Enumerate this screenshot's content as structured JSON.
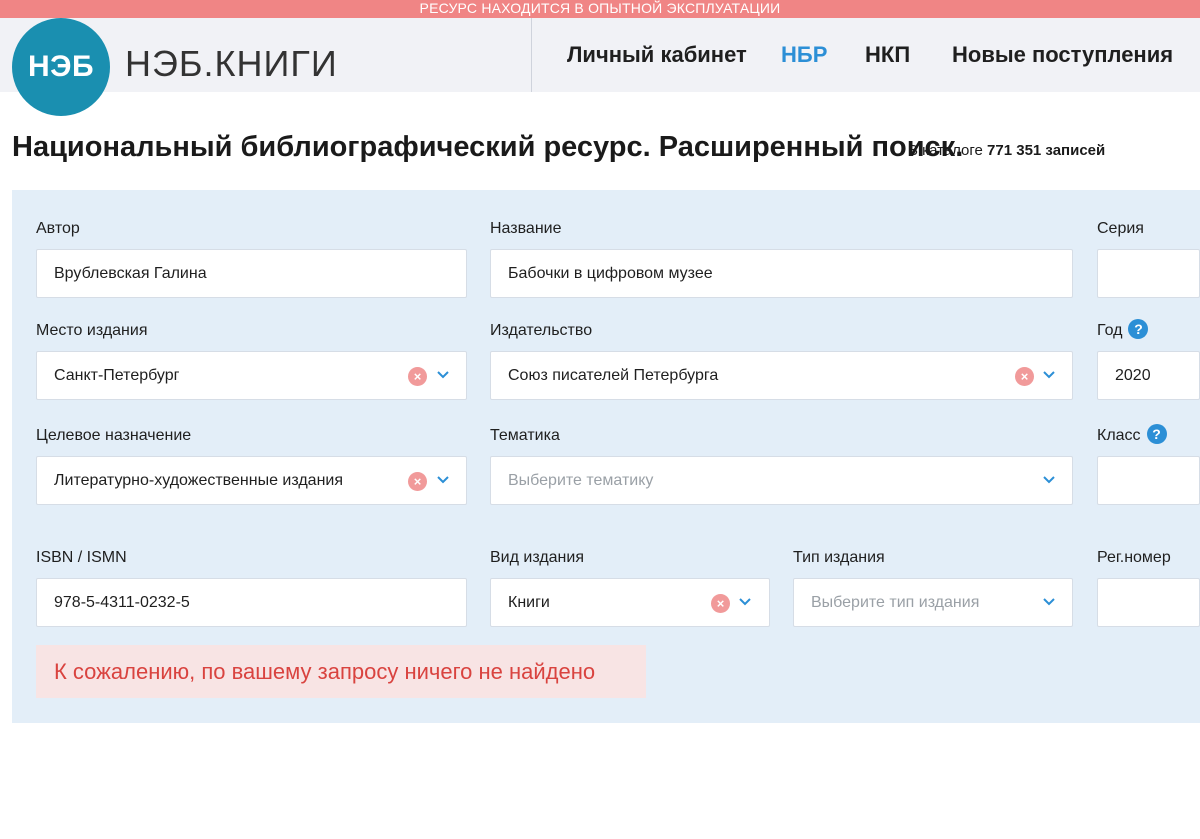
{
  "banner": "РЕСУРС НАХОДИТСЯ В ОПЫТНОЙ ЭКСПЛУАТАЦИИ",
  "logo": {
    "mark": "НЭБ",
    "text": "НЭБ.КНИГИ"
  },
  "nav": [
    {
      "label": "Личный кабинет",
      "active": false
    },
    {
      "label": "НБР",
      "active": true
    },
    {
      "label": "НКП",
      "active": false
    },
    {
      "label": "Новые поступления",
      "active": false
    }
  ],
  "page": {
    "title": "Национальный библиографический ресурс. Расширенный поиск.",
    "catalog_prefix": "В каталоге",
    "catalog_count": "771 351 записей"
  },
  "form": {
    "author": {
      "label": "Автор",
      "value": "Врублевская Галина"
    },
    "title": {
      "label": "Название",
      "value": "Бабочки в цифровом музее"
    },
    "series": {
      "label": "Серия",
      "value": ""
    },
    "place": {
      "label": "Место издания",
      "value": "Санкт-Петербург"
    },
    "publisher": {
      "label": "Издательство",
      "value": "Союз писателей Петербурга"
    },
    "year": {
      "label": "Год",
      "value": "2020"
    },
    "purpose": {
      "label": "Целевое назначение",
      "value": "Литературно-художественные издания"
    },
    "subject": {
      "label": "Тематика",
      "placeholder": "Выберите тематику"
    },
    "class": {
      "label": "Класс",
      "value": ""
    },
    "isbn": {
      "label": "ISBN / ISMN",
      "value": "978-5-4311-0232-5"
    },
    "edition_kind": {
      "label": "Вид издания",
      "value": "Книги"
    },
    "edition_type": {
      "label": "Тип издания",
      "placeholder": "Выберите тип издания"
    },
    "reg_number": {
      "label": "Рег.номер",
      "value": ""
    }
  },
  "help_glyph": "?",
  "clear_glyph": "×",
  "error": "К сожалению, по вашему запросу ничего не найдено",
  "colors": {
    "banner": "#f08585",
    "logo": "#1a8fb0",
    "accent": "#2c8fd6",
    "panel": "#e3eef8",
    "error_text": "#d9433f",
    "error_bg": "#f8e4e4"
  }
}
